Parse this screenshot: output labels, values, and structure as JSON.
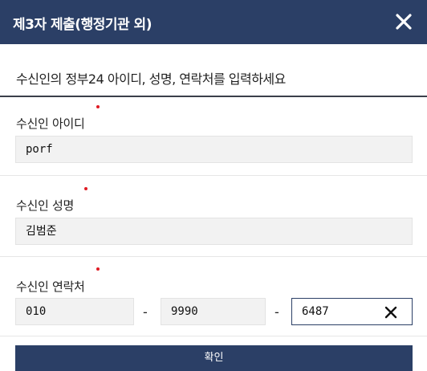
{
  "dialog": {
    "title": "제3자 제출(행정기관 외)"
  },
  "instruction": "수신인의 정부24 아이디, 성명, 연락처를 입력하세요",
  "fields": {
    "user_id": {
      "label": "수신인 아이디",
      "value": "porf"
    },
    "name": {
      "label": "수신인 성명",
      "value": "김범준"
    },
    "phone": {
      "label": "수신인 연락처",
      "part1": "010",
      "part2": "9990",
      "part3": "6487",
      "separator": "-"
    }
  },
  "buttons": {
    "confirm": "확인"
  },
  "colors": {
    "header_bg": "#2b3f66",
    "required_dot": "#e01b24"
  },
  "icons": {
    "close": "close-icon",
    "clear": "clear-icon"
  }
}
